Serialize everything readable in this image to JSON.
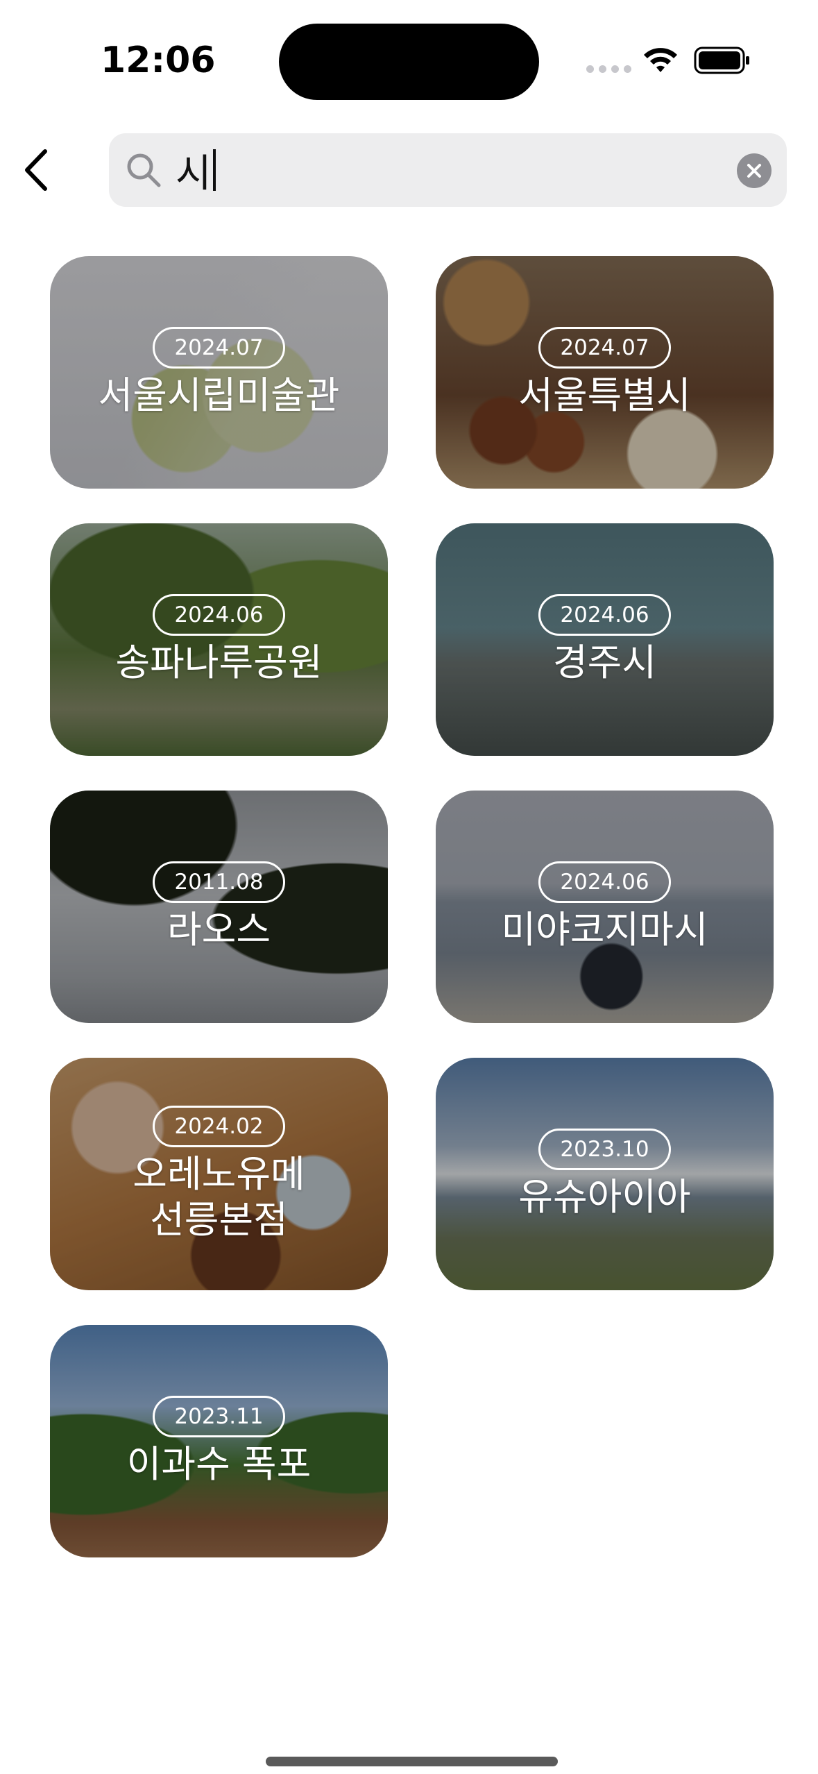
{
  "status_bar": {
    "time": "12:06"
  },
  "search": {
    "query": "시",
    "back_icon": "chevron-left-icon",
    "search_icon": "magnifying-glass-icon",
    "clear_icon": "clear-x-icon"
  },
  "results": [
    {
      "date": "2024.07",
      "title": "서울시립미술관"
    },
    {
      "date": "2024.07",
      "title": "서울특별시"
    },
    {
      "date": "2024.06",
      "title": "송파나루공원"
    },
    {
      "date": "2024.06",
      "title": "경주시"
    },
    {
      "date": "2011.08",
      "title": "라오스"
    },
    {
      "date": "2024.06",
      "title": "미야코지마시"
    },
    {
      "date": "2024.02",
      "title": "오레노유메\n선릉본점"
    },
    {
      "date": "2023.10",
      "title": "유슈아이아"
    },
    {
      "date": "2023.11",
      "title": "이과수 폭포"
    }
  ],
  "colors": {
    "search_background": "#ededee",
    "clear_button": "#8e8e93",
    "card_text": "#ffffff"
  }
}
